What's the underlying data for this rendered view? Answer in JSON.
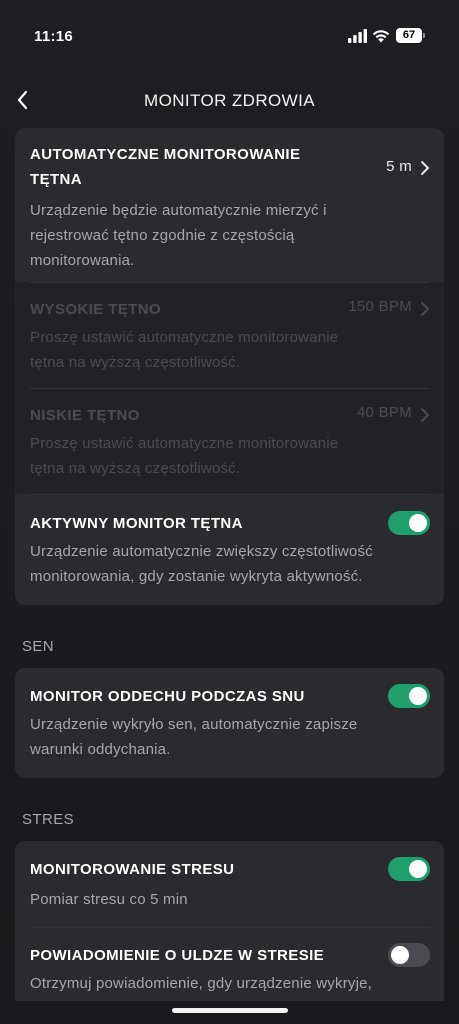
{
  "status_bar": {
    "time": "11:16",
    "battery": "67"
  },
  "nav": {
    "title": "MONITOR ZDROWIA"
  },
  "heart_card": {
    "auto": {
      "title_line1": "AUTOMATYCZNE MONITOROWANIE",
      "title_line2": "TĘTNA",
      "value": "5 m",
      "desc": [
        "Urządzenie będzie automatycznie mierzyć i",
        "rejestrować tętno zgodnie z częstością",
        "monitorowania."
      ]
    },
    "high": {
      "title": "WYSOKIE TĘTNO",
      "value": "150 BPM",
      "desc": [
        "Proszę ustawić automatyczne monitorowanie",
        "tętna na wyższą częstotliwość."
      ]
    },
    "low": {
      "title": "NISKIE TĘTNO",
      "value": "40 BPM",
      "desc": [
        "Proszę ustawić automatyczne monitorowanie",
        "tętna na wyższą częstotliwość."
      ]
    },
    "active": {
      "title": "AKTYWNY MONITOR TĘTNA",
      "enabled": true,
      "desc": [
        "Urządzenie automatycznie zwiększy częstotliwość",
        "monitorowania, gdy zostanie wykryta aktywność."
      ]
    }
  },
  "sleep_section": {
    "header": "SEN",
    "breath": {
      "title": "MONITOR ODDECHU PODCZAS SNU",
      "enabled": true,
      "desc": [
        "Urządzenie wykryło sen, automatycznie zapisze",
        "warunki oddychania."
      ]
    }
  },
  "stress_section": {
    "header": "STRES",
    "monitor": {
      "title": "MONITOROWANIE STRESU",
      "enabled": true,
      "desc": [
        "Pomiar stresu co 5 min"
      ]
    },
    "relief": {
      "title": "POWIADOMIENIE O ULDZE W STRESIE",
      "enabled": false,
      "desc": [
        "Otrzymuj powiadomienie, gdy urządzenie wykryje,"
      ]
    }
  },
  "colors": {
    "accent": "#1f9f6c",
    "card": "#2a2b2f",
    "background": "#1c1c1e"
  }
}
